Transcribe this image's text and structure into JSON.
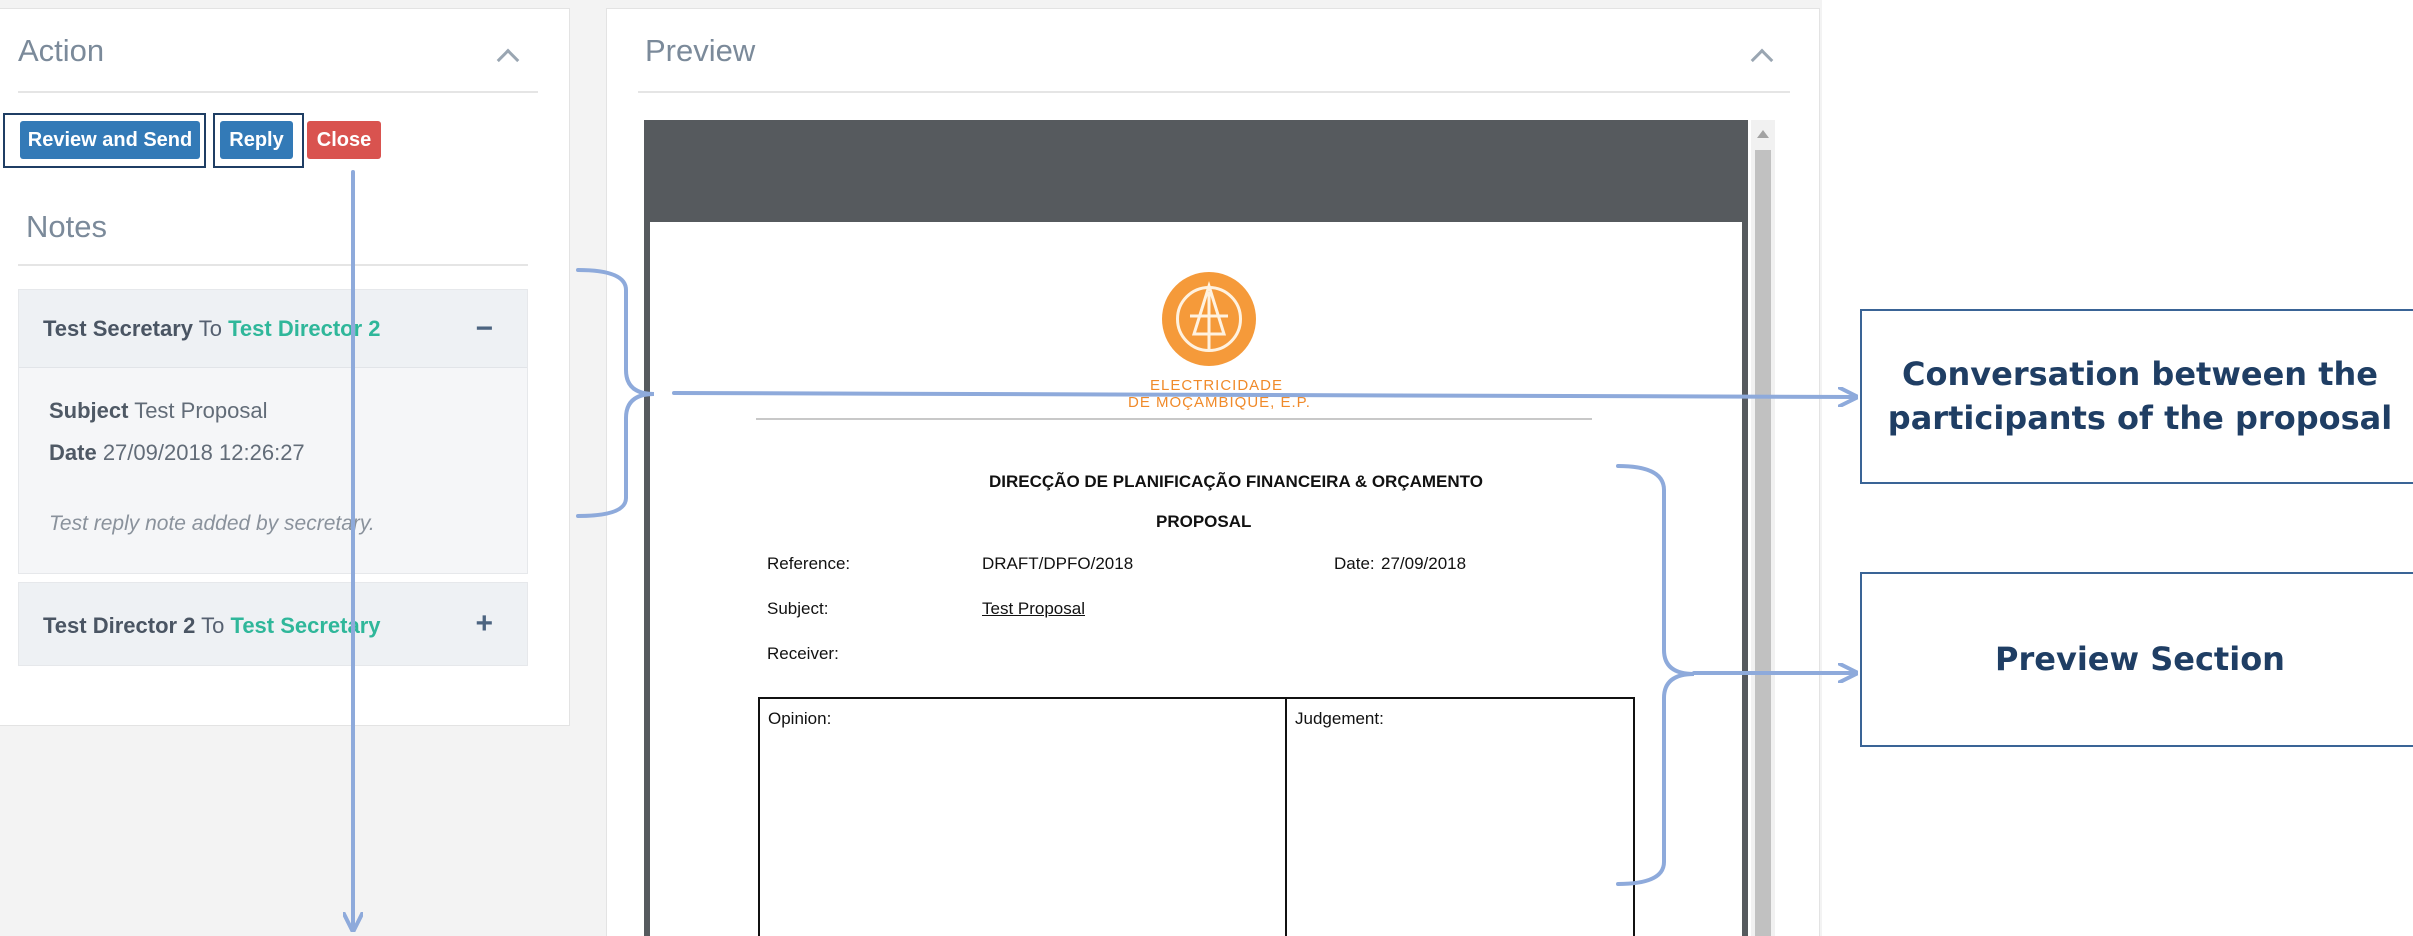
{
  "action_panel": {
    "title": "Action",
    "buttons": {
      "review_send": "Review and Send",
      "reply": "Reply",
      "close": "Close"
    },
    "notes": {
      "title": "Notes",
      "items": [
        {
          "from": "Test Secretary",
          "to_word": "To",
          "to": "Test Director 2",
          "toggle": "−",
          "subject_label": "Subject",
          "subject": "Test Proposal",
          "date_label": "Date",
          "date": "27/09/2018 12:26:27",
          "body": "Test reply note added by secretary."
        },
        {
          "from": "Test Director 2",
          "to_word": "To",
          "to": "Test Secretary",
          "toggle": "+"
        }
      ]
    }
  },
  "preview_panel": {
    "title": "Preview",
    "document": {
      "logo_line1": "ELECTRICIDADE",
      "logo_line2": "DE MOÇAMBIQUE, E.P.",
      "department": "DIRECÇÃO DE PLANIFICAÇÃO FINANCEIRA & ORÇAMENTO",
      "doc_type": "PROPOSAL",
      "reference_label": "Reference:",
      "reference": "DRAFT/DPFO/2018",
      "date_label": "Date:",
      "date": "27/09/2018",
      "subject_label": "Subject:",
      "subject": "Test Proposal",
      "receiver_label": "Receiver:",
      "opinion_label": "Opinion:",
      "judgement_label": "Judgement:"
    }
  },
  "callouts": {
    "conversation": "Conversation between the participants of the proposal",
    "preview": "Preview Section"
  },
  "colors": {
    "primary": "#337ab7",
    "danger": "#d9534f",
    "green": "#2fb79a",
    "annotation": "#8eaadb",
    "callout_border": "#3a6496",
    "logo_orange": "#f59a3a"
  }
}
